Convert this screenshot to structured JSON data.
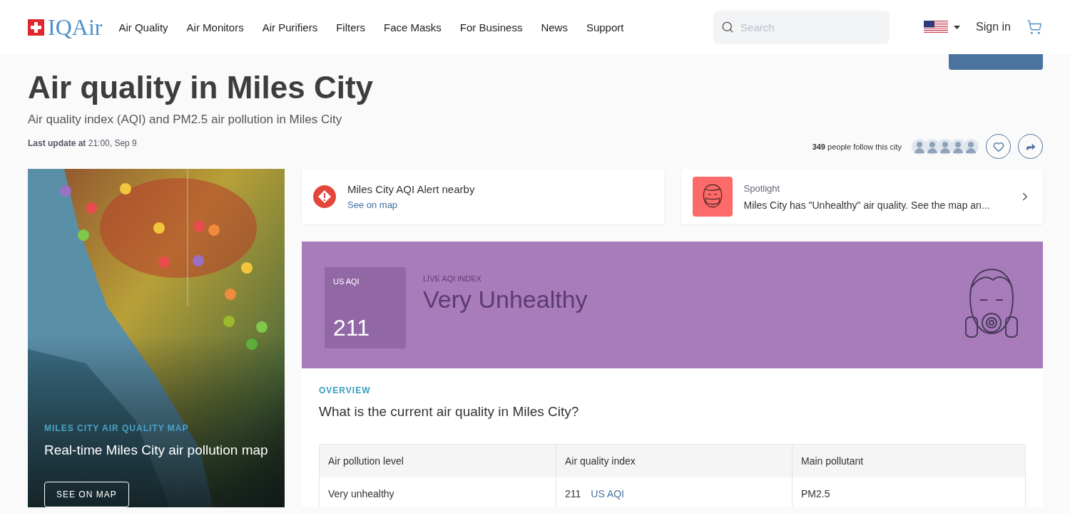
{
  "header": {
    "logo": "IQAir",
    "nav": [
      {
        "label": "Air Quality"
      },
      {
        "label": "Air Monitors"
      },
      {
        "label": "Air Purifiers"
      },
      {
        "label": "Filters"
      },
      {
        "label": "Face Masks"
      },
      {
        "label": "For Business"
      },
      {
        "label": "News"
      },
      {
        "label": "Support"
      }
    ],
    "search": {
      "placeholder": "Search"
    },
    "sign_in": "Sign in"
  },
  "title": "Air quality in Miles City",
  "subtitle": "Air quality index (AQI) and PM2.5 air pollution in Miles City",
  "last_update": {
    "label": "Last update at",
    "value": "21:00, Sep 9"
  },
  "followers": {
    "count": "349",
    "text": "people follow this city"
  },
  "map_card": {
    "eyebrow": "MILES CITY AIR QUALITY MAP",
    "title": "Real-time Miles City air pollution map",
    "button": "SEE ON MAP"
  },
  "alert": {
    "title": "Miles City AQI Alert nearby",
    "link": "See on map"
  },
  "spotlight": {
    "label": "Spotlight",
    "text": "Miles City has \"Unhealthy\" air quality. See the map an..."
  },
  "aqi": {
    "unit": "US AQI",
    "value": "211",
    "label": "LIVE AQI INDEX",
    "status": "Very Unhealthy",
    "color": "#a87cbb"
  },
  "overview": {
    "eyebrow": "OVERVIEW",
    "question": "What is the current air quality in Miles City?",
    "table": {
      "columns": [
        "Air pollution level",
        "Air quality index",
        "Main pollutant"
      ],
      "rows": [
        {
          "level": "Very unhealthy",
          "index": "211",
          "unit": "US AQI",
          "pollutant": "PM2.5"
        }
      ]
    }
  }
}
